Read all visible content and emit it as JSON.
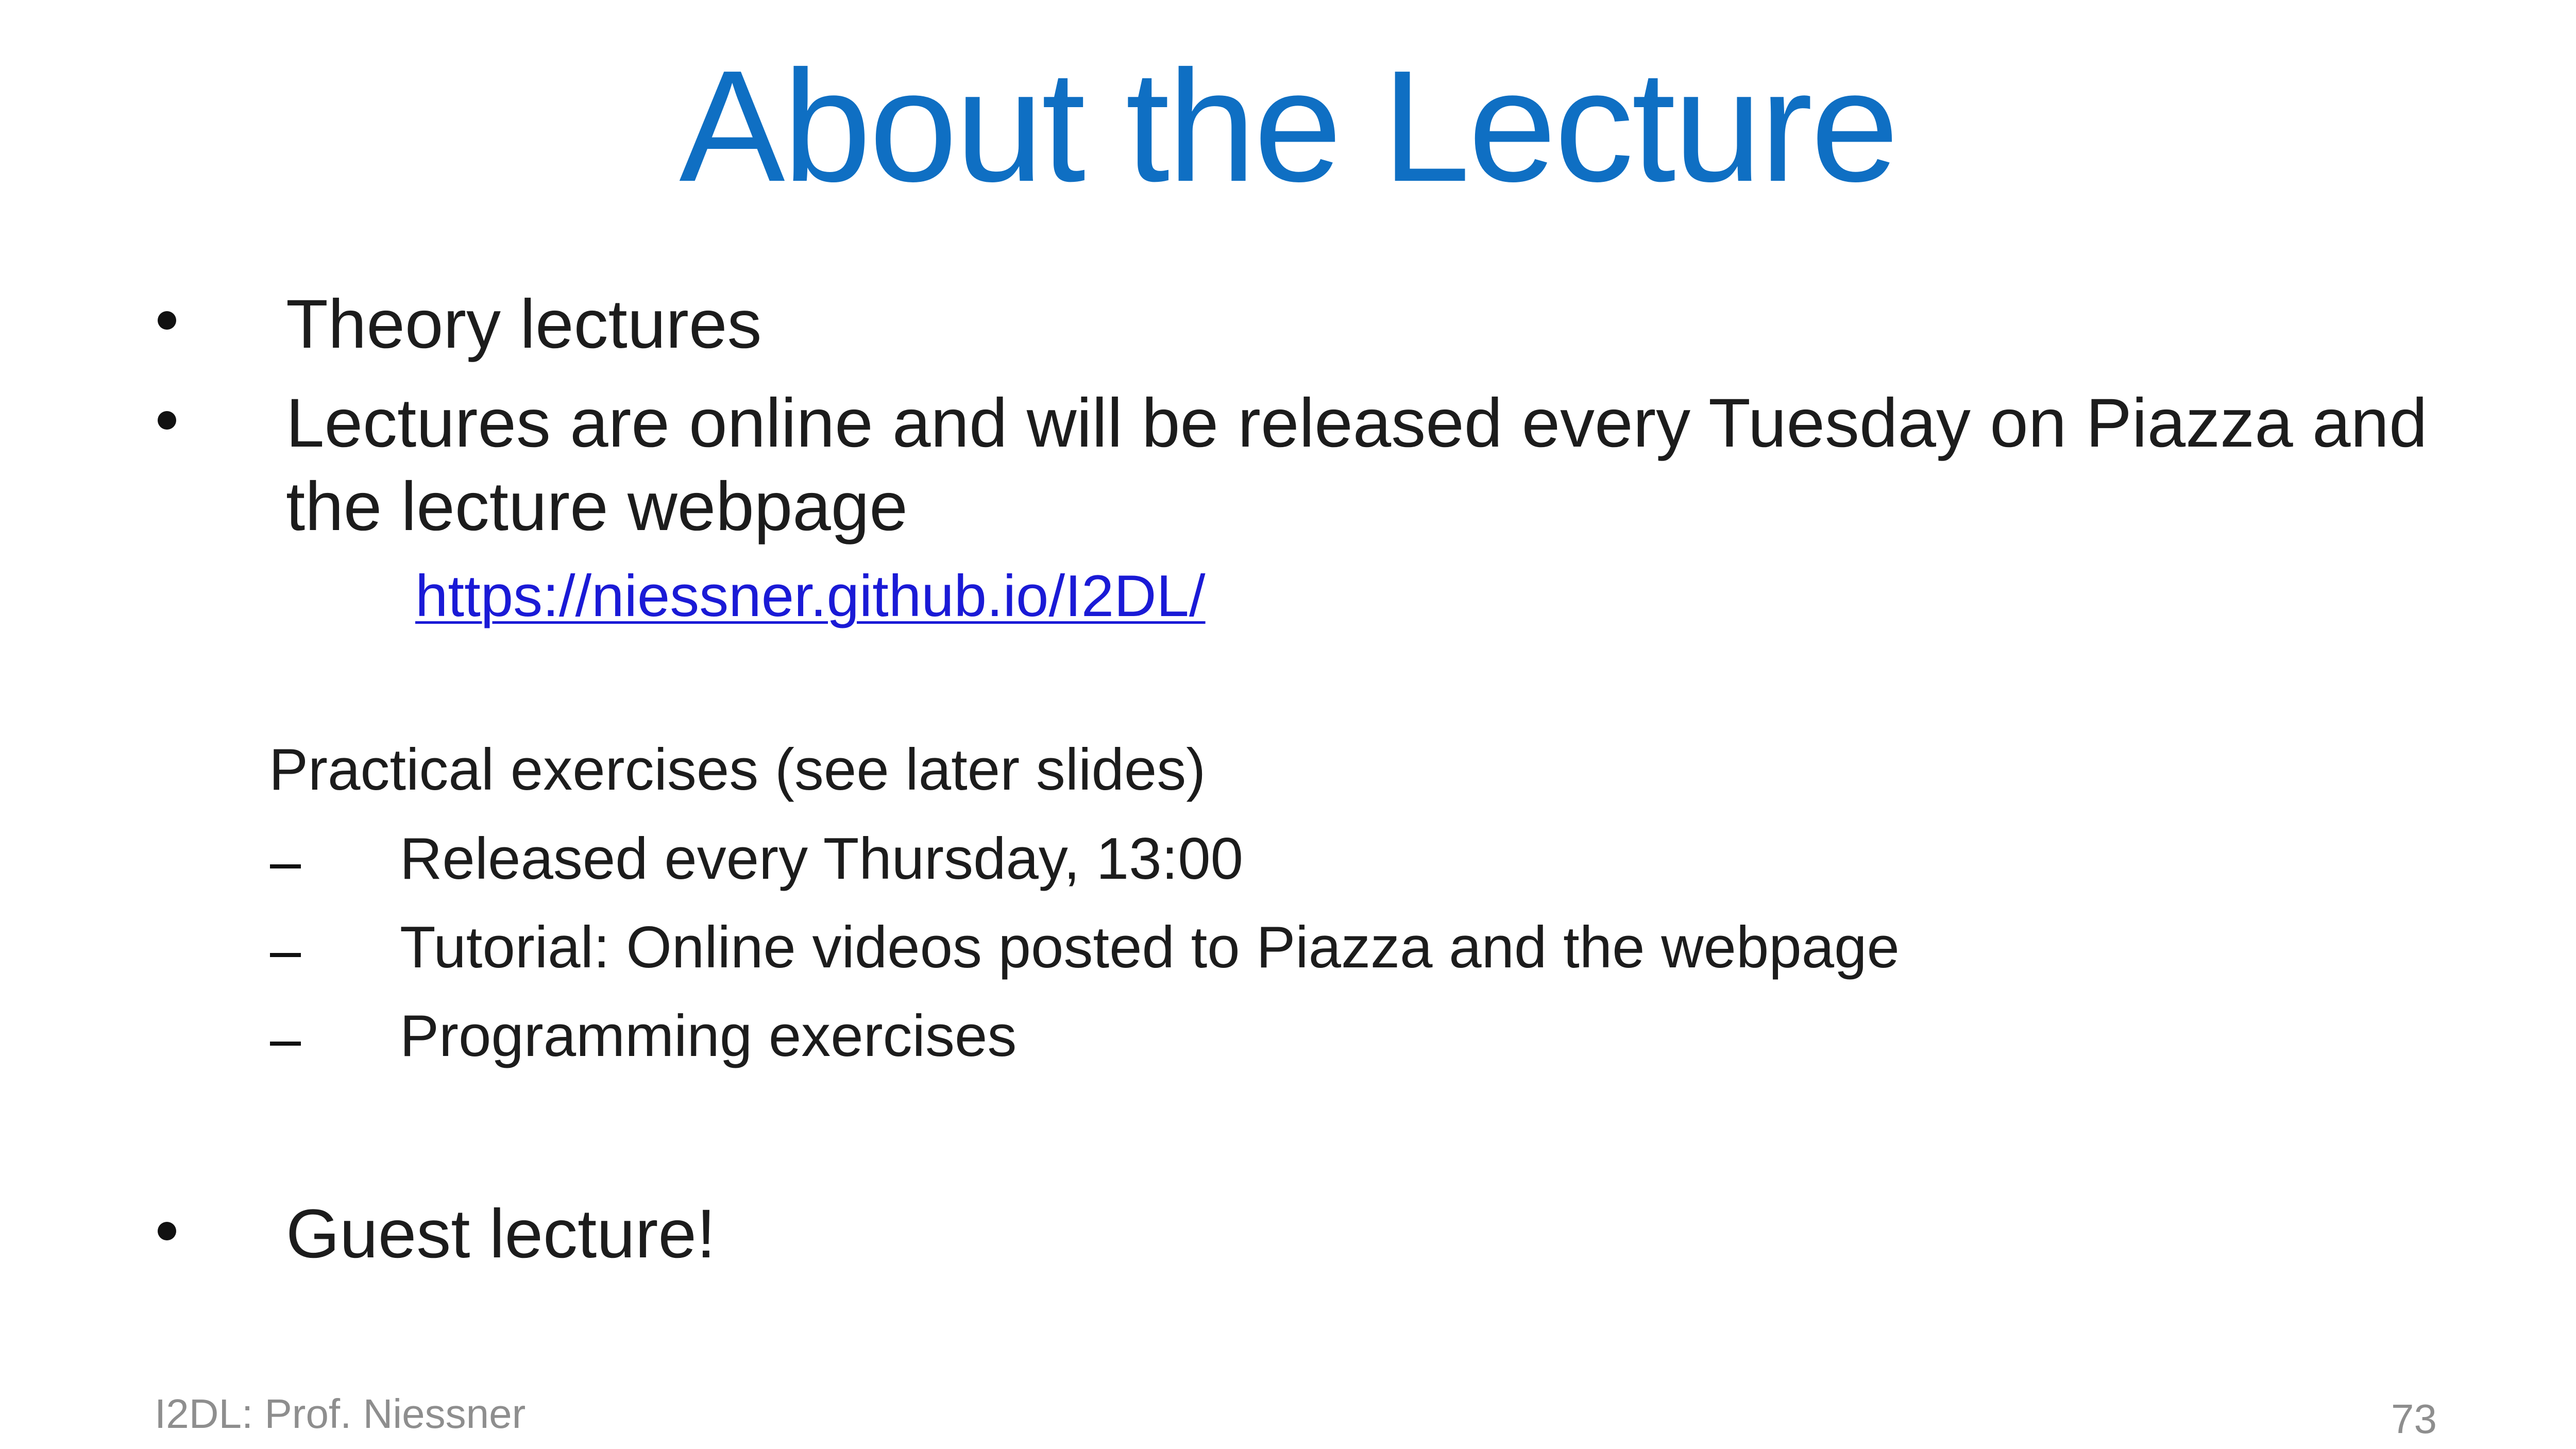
{
  "slide": {
    "title": "About the Lecture",
    "bullets": [
      {
        "text": "Theory lectures"
      },
      {
        "line1": "Lectures are online and will be released every Tuesday on Piazza and",
        "line2": "the lecture webpage"
      }
    ],
    "link": "https://niessner.github.io/I2DL/",
    "practical": {
      "heading": "Practical exercises (see later slides)",
      "items": [
        "Released every Thursday, 13:00",
        "Tutorial: Online videos posted to Piazza and the webpage",
        "Programming exercises"
      ]
    },
    "guest": "Guest lecture!",
    "footer": {
      "left": "I2DL: Prof. Niessner",
      "page": "73"
    }
  },
  "colors": {
    "title": "#0f6fc3",
    "text": "#1c1c1c",
    "link": "#1a1ad6",
    "footer": "#8e8e8e"
  }
}
